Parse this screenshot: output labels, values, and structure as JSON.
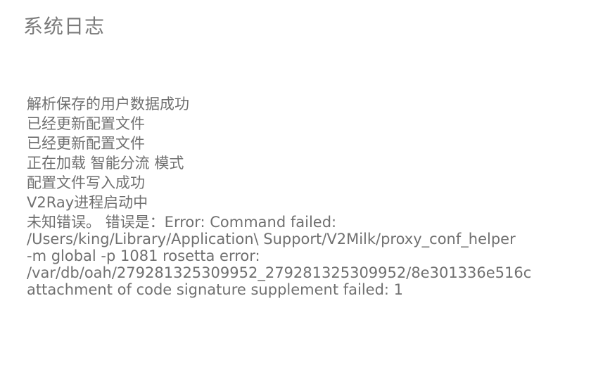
{
  "window": {
    "title": "系统日志"
  },
  "logs": [
    "解析保存的用户数据成功",
    "已经更新配置文件",
    "已经更新配置文件",
    "正在加载 智能分流 模式",
    "配置文件写入成功",
    "V2Ray进程启动中"
  ],
  "error_log": {
    "lines": [
      "未知错误。 错误是：Error: Command failed:",
      "/Users/king/Library/Application\\ Support/V2Milk/proxy_conf_helper",
      "-m global -p 1081 rosetta error:",
      "/var/db/oah/279281325309952_279281325309952/8e301336e516c",
      "attachment of code signature supplement failed: 1"
    ]
  }
}
